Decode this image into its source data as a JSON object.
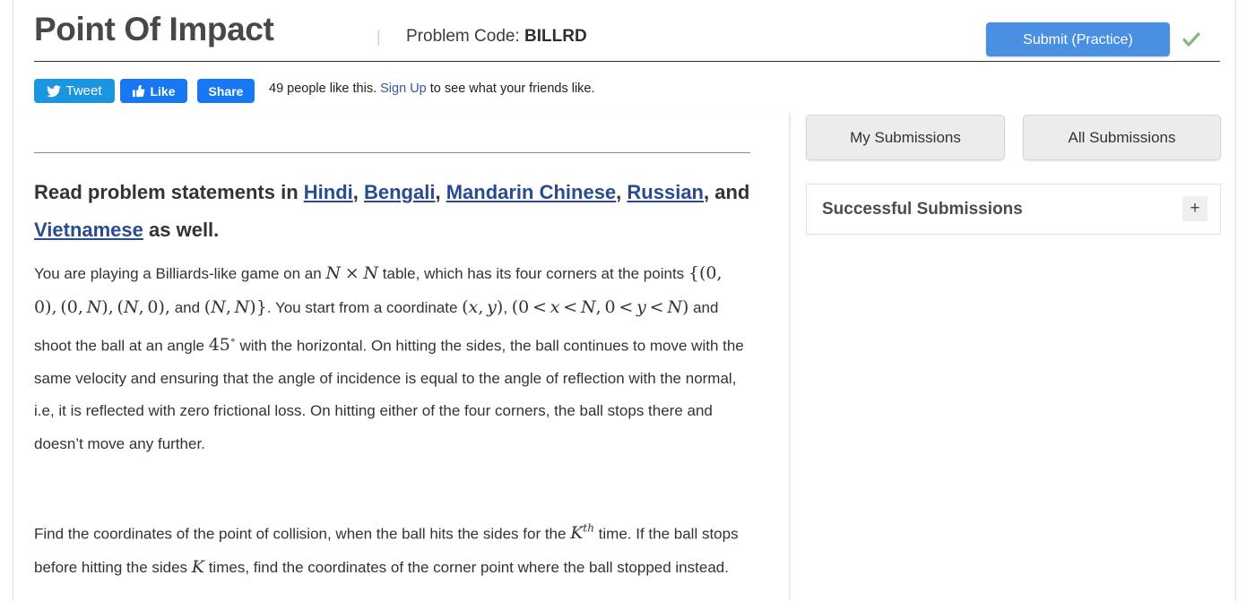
{
  "header": {
    "title": "Point Of Impact",
    "separator": "|",
    "problem_code_label": "Problem Code:",
    "problem_code": "BILLRD",
    "submit_label": "Submit (Practice)",
    "submit_color": "#4a90e2",
    "check_icon": "green-check-icon",
    "check_color": "#7fba7a"
  },
  "social": {
    "tweet_label": "Tweet",
    "tweet_icon": "twitter-bird-icon",
    "tweet_color": "#1b95e0",
    "like_label": "Like",
    "like_icon": "thumbs-up-icon",
    "like_color": "#1877f2",
    "share_label": "Share",
    "share_color": "#1877f2",
    "like_count_prefix": "49 people like this.",
    "sign_up_label": "Sign Up",
    "like_count_suffix": "to see what your friends like."
  },
  "content": {
    "lang_heading_prefix": "Read problem statements in ",
    "lang_links": [
      "Hindi",
      "Bengali",
      "Mandarin Chinese",
      "Russian",
      "Vietnamese"
    ],
    "lang_heading_suffix": " as well.",
    "paragraph_1": "You are playing a Billiards-like game on an N × N table, which has its four corners at the points {(0, 0), (0, N), (N, 0), and (N, N)}. You start from a coordinate (x, y), (0 < x < N, 0 < y < N) and shoot the ball at an angle 45° with the horizontal. On hitting the sides, the ball continues to move with the same velocity and ensuring that the angle of incidence is equal to the angle of reflection with the normal, i.e, it is reflected with zero frictional loss. On hitting either of the four corners, the ball stops there and doesn’t move any further.",
    "paragraph_2": "Find the coordinates of the point of collision, when the ball hits the sides for the Kth time. If the ball stops before hitting the sides K times, find the coordinates of the corner point where the ball stopped instead."
  },
  "sidebar": {
    "tab_my_submissions": "My Submissions",
    "tab_all_submissions": "All Submissions",
    "panel_title": "Successful Submissions",
    "expand_icon": "plus-icon",
    "expand_label": "+"
  }
}
